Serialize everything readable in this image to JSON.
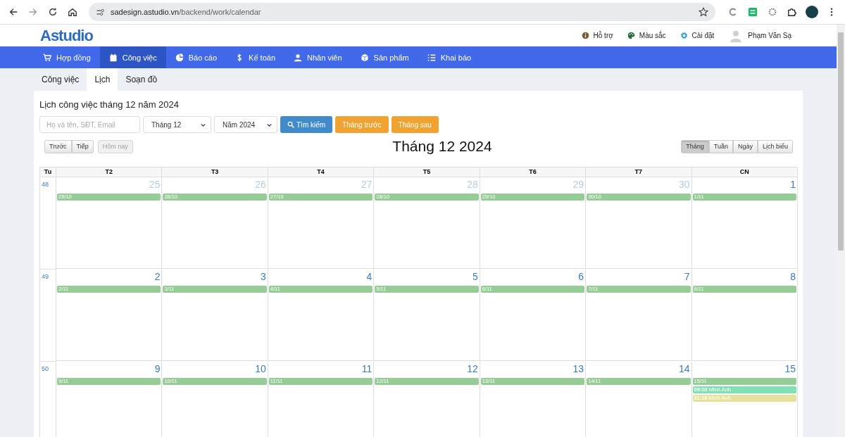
{
  "browser": {
    "url_host": "sadesign.astudio.vn",
    "url_path": "/backend/work/calendar"
  },
  "header": {
    "logo": "Astudio",
    "links": [
      {
        "label": "Hỗ trợ"
      },
      {
        "label": "Màu sắc"
      },
      {
        "label": "Cài đặt"
      }
    ],
    "user": "Phạm Văn Sạ"
  },
  "nav": [
    {
      "label": "Hợp đồng",
      "selected": false
    },
    {
      "label": "Công việc",
      "selected": true
    },
    {
      "label": "Báo cáo",
      "selected": false
    },
    {
      "label": "Kế toán",
      "selected": false
    },
    {
      "label": "Nhân viên",
      "selected": false
    },
    {
      "label": "Sản phẩm",
      "selected": false
    },
    {
      "label": "Khai báo",
      "selected": false
    }
  ],
  "subtabs": [
    {
      "label": "Công việc",
      "selected": false
    },
    {
      "label": "Lịch",
      "selected": true
    },
    {
      "label": "Soạn đồ",
      "selected": false
    }
  ],
  "title": "Lịch công việc tháng 12 năm 2024",
  "search": {
    "placeholder": "Họ và tên, SĐT, Email"
  },
  "month_select": "Tháng 12",
  "year_select": "Năm 2024",
  "buttons": [
    {
      "label": "Tìm kiếm",
      "kind": "primary"
    },
    {
      "label": "Tháng trước",
      "kind": "warning"
    },
    {
      "label": "Tháng sau",
      "kind": "warning"
    }
  ],
  "calendar": {
    "prev": "Trước",
    "next": "Tiếp",
    "today": {
      "label": "Hôm nay",
      "disabled": true
    },
    "title": "Tháng 12 2024",
    "views": [
      {
        "label": "Tháng",
        "selected": true
      },
      {
        "label": "Tuần",
        "selected": false
      },
      {
        "label": "Ngày",
        "selected": false
      },
      {
        "label": "Lịch biểu",
        "selected": false
      }
    ],
    "week_header": "Tu",
    "days": [
      "T2",
      "T3",
      "T4",
      "T5",
      "T6",
      "T7",
      "CN"
    ],
    "weeks": [
      {
        "number": "48",
        "days": [
          {
            "date": "25",
            "other_month": true,
            "events": [
              {
                "text": "25/10",
                "color": "#96cc96"
              }
            ]
          },
          {
            "date": "26",
            "other_month": true,
            "events": [
              {
                "text": "26/10",
                "color": "#96cc96"
              }
            ]
          },
          {
            "date": "27",
            "other_month": true,
            "events": [
              {
                "text": "27/10",
                "color": "#96cc96"
              }
            ]
          },
          {
            "date": "28",
            "other_month": true,
            "events": [
              {
                "text": "28/10",
                "color": "#96cc96"
              }
            ]
          },
          {
            "date": "29",
            "other_month": true,
            "events": [
              {
                "text": "29/10",
                "color": "#96cc96"
              }
            ]
          },
          {
            "date": "30",
            "other_month": true,
            "events": [
              {
                "text": "30/10",
                "color": "#96cc96"
              }
            ]
          },
          {
            "date": "1",
            "other_month": false,
            "events": [
              {
                "text": "1/11",
                "color": "#96cc96"
              }
            ]
          }
        ]
      },
      {
        "number": "49",
        "days": [
          {
            "date": "2",
            "other_month": false,
            "events": [
              {
                "text": "2/11",
                "color": "#96cc96"
              }
            ]
          },
          {
            "date": "3",
            "other_month": false,
            "events": [
              {
                "text": "3/11",
                "color": "#96cc96"
              }
            ]
          },
          {
            "date": "4",
            "other_month": false,
            "events": [
              {
                "text": "4/11",
                "color": "#96cc96"
              }
            ]
          },
          {
            "date": "5",
            "other_month": false,
            "events": [
              {
                "text": "5/11",
                "color": "#96cc96"
              }
            ]
          },
          {
            "date": "6",
            "other_month": false,
            "events": [
              {
                "text": "6/11",
                "color": "#96cc96"
              }
            ]
          },
          {
            "date": "7",
            "other_month": false,
            "events": [
              {
                "text": "7/11",
                "color": "#96cc96"
              }
            ]
          },
          {
            "date": "8",
            "other_month": false,
            "events": [
              {
                "text": "8/11",
                "color": "#96cc96"
              }
            ]
          }
        ]
      },
      {
        "number": "50",
        "days": [
          {
            "date": "9",
            "other_month": false,
            "events": [
              {
                "text": "9/11",
                "color": "#96cc96"
              }
            ]
          },
          {
            "date": "10",
            "other_month": false,
            "events": [
              {
                "text": "10/11",
                "color": "#96cc96"
              }
            ]
          },
          {
            "date": "11",
            "other_month": false,
            "events": [
              {
                "text": "11/11",
                "color": "#96cc96"
              }
            ]
          },
          {
            "date": "12",
            "other_month": false,
            "events": [
              {
                "text": "12/11",
                "color": "#96cc96"
              }
            ]
          },
          {
            "date": "13",
            "other_month": false,
            "events": [
              {
                "text": "13/11",
                "color": "#96cc96"
              }
            ]
          },
          {
            "date": "14",
            "other_month": false,
            "events": [
              {
                "text": "14/11",
                "color": "#96cc96"
              }
            ]
          },
          {
            "date": "15",
            "other_month": false,
            "events": [
              {
                "text": "15/11",
                "color": "#96cc96"
              },
              {
                "time": "09:03",
                "text": "Minh Anh",
                "color": "#7fe0b6"
              },
              {
                "time": "11:10",
                "text": "Minh Anh",
                "color": "#e6e29c"
              }
            ]
          }
        ]
      }
    ]
  }
}
